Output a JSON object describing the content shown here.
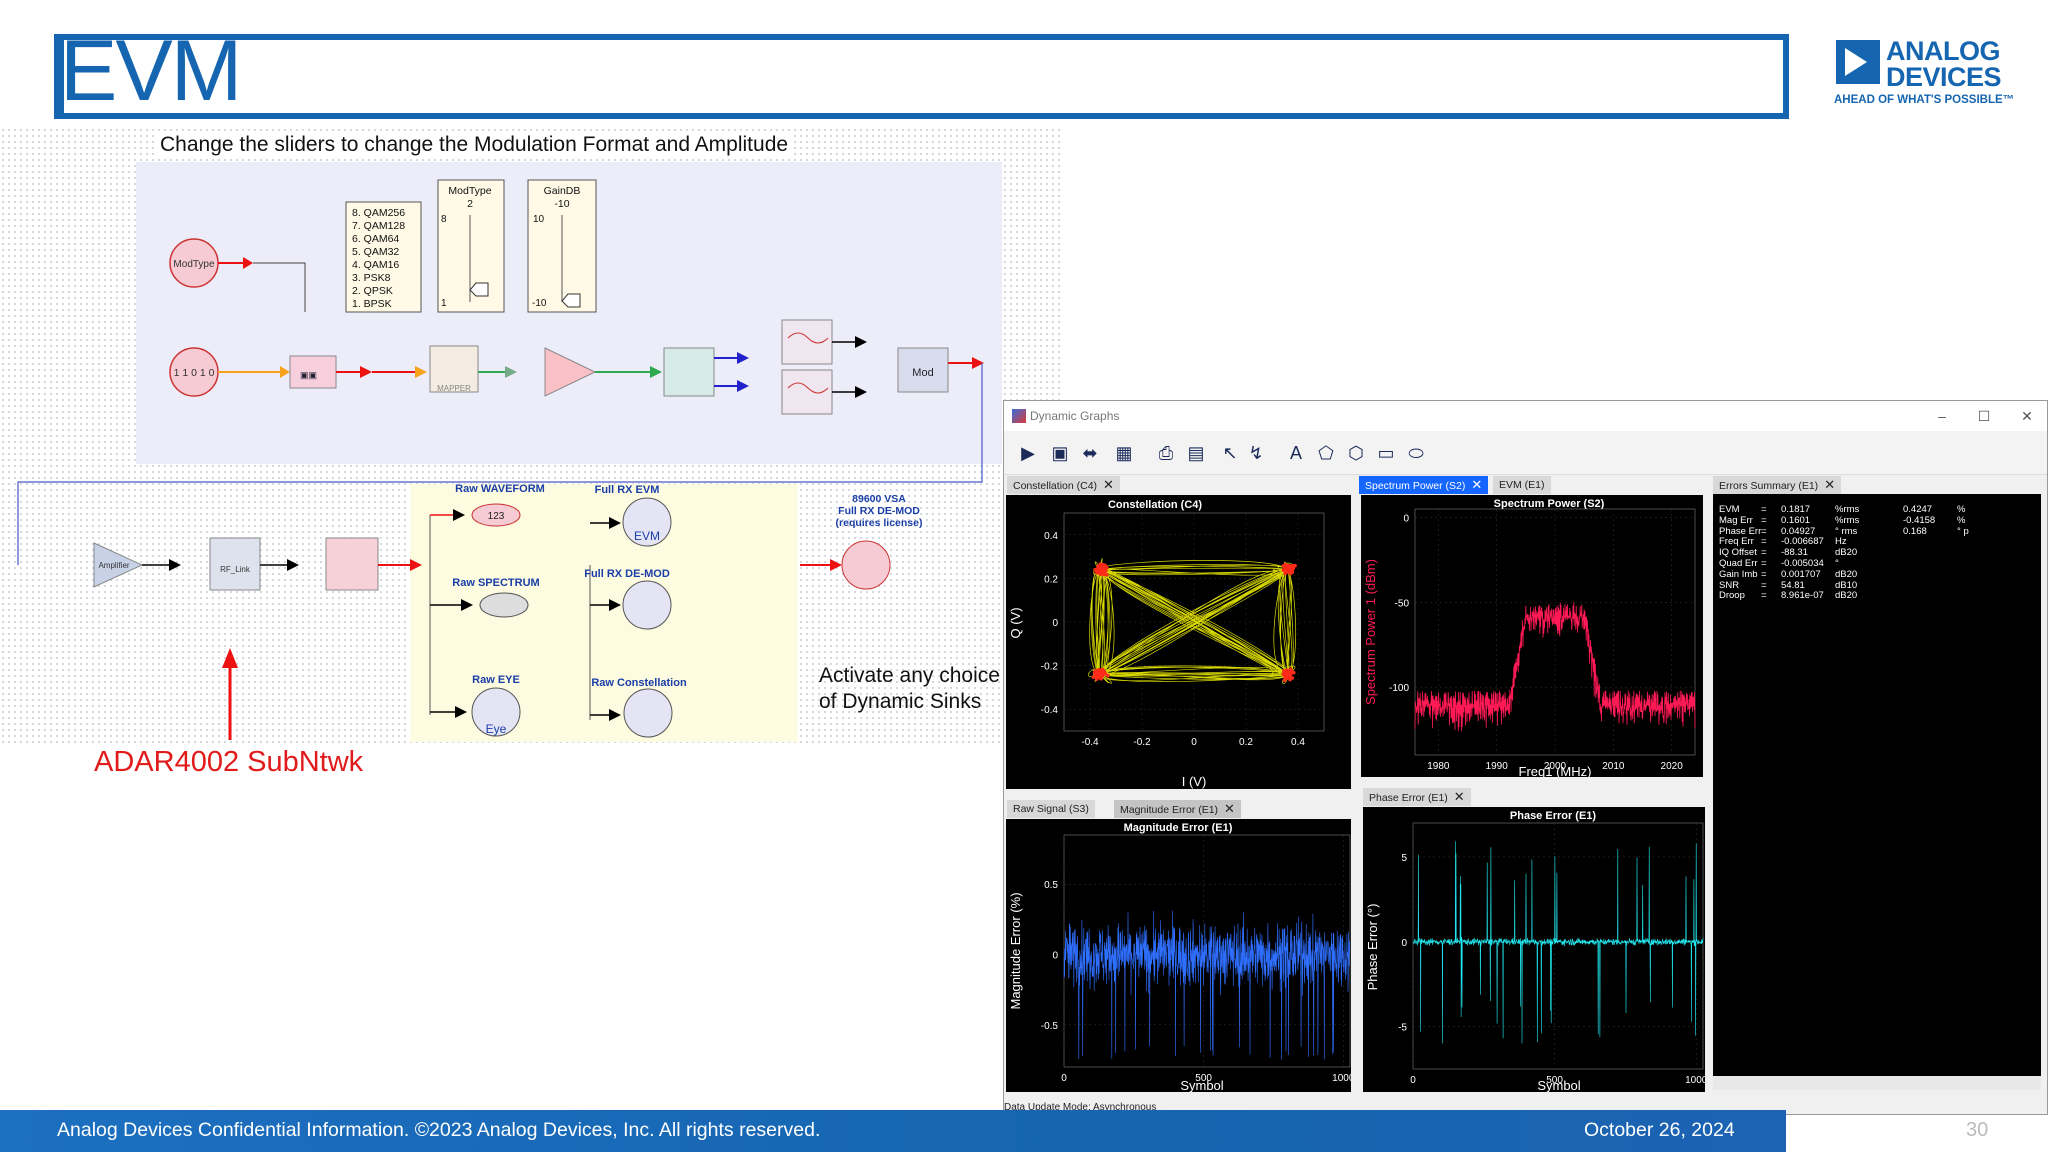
{
  "slide": {
    "title": "EVM",
    "instruction": "Change the sliders to change the Modulation Format and Amplitude",
    "subnetwork_label": "ADAR4002 SubNtwk",
    "dynamic_sinks_line1": "Activate any choice",
    "dynamic_sinks_line2": "of Dynamic Sinks",
    "footer": "Analog Devices Confidential Information. ©2023 Analog Devices, Inc. All rights reserved.",
    "date": "October 26, 2024",
    "page_number": "30"
  },
  "logo": {
    "line1": "ANALOG",
    "line2": "DEVICES",
    "tagline": "AHEAD OF WHAT'S POSSIBLE™"
  },
  "schematic": {
    "modtype_circle": "ModType",
    "bits_circle": "1 1 0 1 0",
    "modulation_list": [
      "8. QAM256",
      "7. QAM128",
      "6. QAM64",
      "5. QAM32",
      "4. QAM16",
      "3. PSK8",
      "2. QPSK",
      "1. BPSK"
    ],
    "modtype_slider": {
      "title": "ModType",
      "value": "2",
      "max": "8",
      "min": "1"
    },
    "gain_slider": {
      "title": "GainDB",
      "value": "-10",
      "max": "10",
      "min": "-10"
    },
    "blocks": {
      "mapper": "MAPPER",
      "mod": "Mod",
      "amplifier": "Amplifier",
      "rf_link": "RF_Link",
      "raw_waveform": "Raw WAVEFORM",
      "waveform_value": "123",
      "raw_spectrum": "Raw SPECTRUM",
      "raw_eye": "Raw EYE",
      "eye": "Eye",
      "full_rx_evm": "Full RX EVM",
      "evm": "EVM",
      "full_rx_demod": "Full RX DE-MOD",
      "raw_constellation": "Raw Constellation",
      "vsa_line1": "89600 VSA",
      "vsa_line2": "Full RX DE-MOD",
      "vsa_line3": "(requires license)"
    }
  },
  "dynamic_graphs": {
    "window_title": "Dynamic Graphs",
    "status": "Data Update Mode: Asynchronous",
    "tabs_top_left": [
      {
        "label": "Constellation (C4)",
        "active": false
      }
    ],
    "tabs_top_mid": [
      {
        "label": "Spectrum Power (S2)",
        "active": true
      },
      {
        "label": "EVM (E1)",
        "active": false
      }
    ],
    "tabs_right": [
      {
        "label": "Errors Summary (E1)",
        "active": false
      }
    ],
    "tabs_bottom_left": [
      {
        "label": "Raw Signal (S3)",
        "active": false
      },
      {
        "label": "Magnitude Error (E1)",
        "active": false
      }
    ],
    "tabs_bottom_mid": [
      {
        "label": "Phase Error (E1)",
        "active": false
      }
    ],
    "errors_summary": [
      {
        "name": "EVM",
        "eq": "=",
        "value": "0.1817",
        "unit": "%rms",
        "v2": "0.4247",
        "u2": "%"
      },
      {
        "name": "Mag Err",
        "eq": "=",
        "value": "0.1601",
        "unit": "%rms",
        "v2": "-0.4158",
        "u2": "%"
      },
      {
        "name": "Phase Err",
        "eq": "=",
        "value": "0.04927",
        "unit": "° rms",
        "v2": "0.168",
        "u2": "° p"
      },
      {
        "name": "Freq Err",
        "eq": "=",
        "value": "-0.006687",
        "unit": "Hz",
        "v2": "",
        "u2": ""
      },
      {
        "name": "IQ Offset",
        "eq": "=",
        "value": "-88.31",
        "unit": "dB20",
        "v2": "",
        "u2": ""
      },
      {
        "name": "Quad Err",
        "eq": "=",
        "value": "-0.005034",
        "unit": "°",
        "v2": "",
        "u2": ""
      },
      {
        "name": "Gain Imb",
        "eq": "=",
        "value": "0.001707",
        "unit": "dB20",
        "v2": "",
        "u2": ""
      },
      {
        "name": "SNR",
        "eq": "=",
        "value": "54.81",
        "unit": "dB10",
        "v2": "",
        "u2": ""
      },
      {
        "name": "Droop",
        "eq": "=",
        "value": "8.961e-07",
        "unit": "dB20",
        "v2": "",
        "u2": ""
      }
    ]
  },
  "chart_data": [
    {
      "type": "scatter",
      "title": "Constellation (C4)",
      "xlabel": "I (V)",
      "ylabel": "Q (V)",
      "xlim": [
        -0.5,
        0.5
      ],
      "ylim": [
        -0.5,
        0.5
      ],
      "xticks": [
        "-0.4",
        "-0.2",
        "0",
        "0.2",
        "0.4"
      ],
      "yticks": [
        "0.4",
        "0.2",
        "0",
        "-0.2",
        "-0.4"
      ],
      "constellation_points": [
        [
          -0.36,
          0.24
        ],
        [
          0.36,
          0.24
        ],
        [
          -0.36,
          -0.24
        ],
        [
          0.36,
          -0.24
        ]
      ],
      "trace_color": "#ffff00",
      "point_color": "#ff2a1a"
    },
    {
      "type": "line",
      "title": "Spectrum Power (S2)",
      "xlabel": "Freq1 (MHz)",
      "ylabel": "Spectrum Power 1 (dBm)",
      "xlim": [
        1976,
        2024
      ],
      "ylim": [
        -140,
        5
      ],
      "xticks": [
        "1980",
        "1990",
        "2000",
        "2010",
        "2020"
      ],
      "yticks": [
        "0",
        "-50",
        "-100"
      ],
      "center": 2000,
      "occupied_bw": 10,
      "in_band_level": -58,
      "out_of_band_level": -118,
      "trace_color": "#ff1a55"
    },
    {
      "type": "line",
      "title": "Magnitude Error (E1)",
      "xlabel": "Symbol",
      "ylabel": "Magnitude Error (%)",
      "xlim": [
        0,
        1024
      ],
      "ylim": [
        -0.8,
        0.85
      ],
      "xticks": [
        "0",
        "500",
        "1000"
      ],
      "yticks": [
        "0.5",
        "0",
        "-0.5"
      ],
      "trace_color": "#2f6fff"
    },
    {
      "type": "line",
      "title": "Phase Error (E1)",
      "xlabel": "Symbol",
      "ylabel": "Phase Error (°)",
      "xlim": [
        0,
        1024
      ],
      "ylim": [
        -7.5,
        7
      ],
      "xticks": [
        "0",
        "500",
        "1000"
      ],
      "yticks": [
        "5",
        "0",
        "-5"
      ],
      "trace_color": "#22e8f0"
    }
  ],
  "colors": {
    "brand_blue": "#1565b0",
    "red_label": "#e11b1b",
    "tab_active": "#1565ff"
  }
}
